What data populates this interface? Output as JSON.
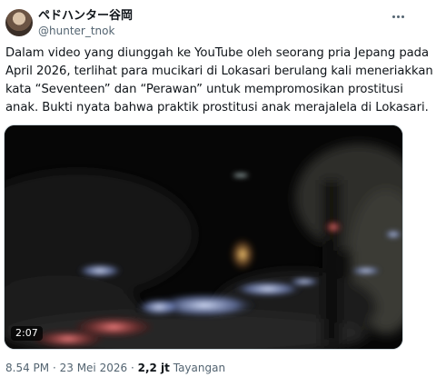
{
  "tweet": {
    "author": {
      "display_name": "ペドハンター谷岡",
      "handle": "@hunter_tnok"
    },
    "more_icon": "more-horizontal-icon",
    "text_lines": [
      "Dalam video yang diunggah ke YouTube oleh seorang pria Jepang pada",
      "April 2026, terlihat para mucikari di Lokasari berulang kali meneriakkan",
      "kata “Seventeen” dan “Perawan” untuk mempromosikan prostitusi",
      "anak. Bukti nyata bahwa praktik prostitusi anak merajalela di Lokasari."
    ],
    "video": {
      "duration": "2:07"
    },
    "meta": {
      "time": "8.54 PM",
      "separator": "·",
      "date": "23 Mei 2026",
      "views": "2,2 jt",
      "views_label": "Tayangan"
    }
  }
}
